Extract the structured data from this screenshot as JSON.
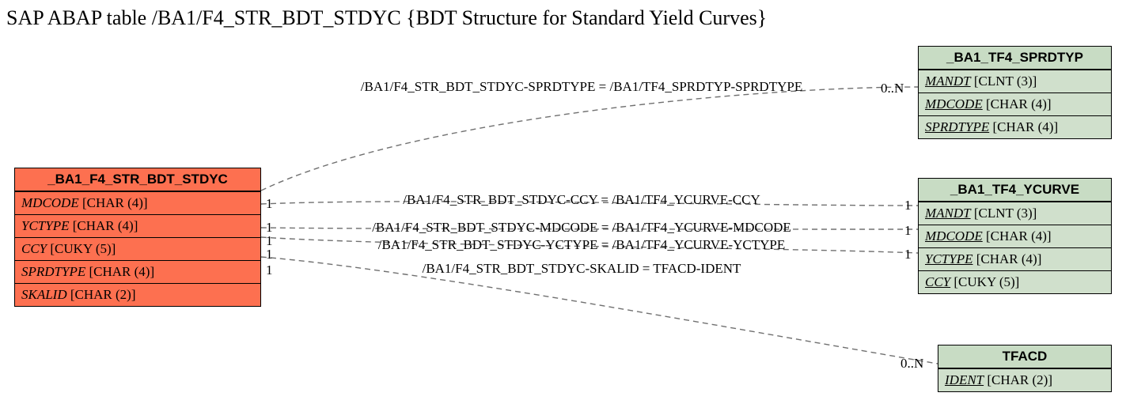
{
  "title": "SAP ABAP table /BA1/F4_STR_BDT_STDYC {BDT Structure for Standard Yield Curves}",
  "left": {
    "name": "_BA1_F4_STR_BDT_STDYC",
    "rows": [
      {
        "name": "MDCODE",
        "type": "[CHAR (4)]",
        "key": false
      },
      {
        "name": "YCTYPE",
        "type": "[CHAR (4)]",
        "key": false
      },
      {
        "name": "CCY",
        "type": "[CUKY (5)]",
        "key": false
      },
      {
        "name": "SPRDTYPE",
        "type": "[CHAR (4)]",
        "key": false
      },
      {
        "name": "SKALID",
        "type": "[CHAR (2)]",
        "key": false
      }
    ]
  },
  "right1": {
    "name": "_BA1_TF4_SPRDTYP",
    "rows": [
      {
        "name": "MANDT",
        "type": "[CLNT (3)]",
        "key": true
      },
      {
        "name": "MDCODE",
        "type": "[CHAR (4)]",
        "key": true
      },
      {
        "name": "SPRDTYPE",
        "type": "[CHAR (4)]",
        "key": true
      }
    ]
  },
  "right2": {
    "name": "_BA1_TF4_YCURVE",
    "rows": [
      {
        "name": "MANDT",
        "type": "[CLNT (3)]",
        "key": true
      },
      {
        "name": "MDCODE",
        "type": "[CHAR (4)]",
        "key": true
      },
      {
        "name": "YCTYPE",
        "type": "[CHAR (4)]",
        "key": true
      },
      {
        "name": "CCY",
        "type": "[CUKY (5)]",
        "key": true
      }
    ]
  },
  "right3": {
    "name": "TFACD",
    "rows": [
      {
        "name": "IDENT",
        "type": "[CHAR (2)]",
        "key": true
      }
    ]
  },
  "rel": {
    "r1": "/BA1/F4_STR_BDT_STDYC-SPRDTYPE = /BA1/TF4_SPRDTYP-SPRDTYPE",
    "r2": "/BA1/F4_STR_BDT_STDYC-CCY = /BA1/TF4_YCURVE-CCY",
    "r3": "/BA1/F4_STR_BDT_STDYC-MDCODE = /BA1/TF4_YCURVE-MDCODE",
    "r4": "/BA1/F4_STR_BDT_STDYC-YCTYPE = /BA1/TF4_YCURVE-YCTYPE",
    "r5": "/BA1/F4_STR_BDT_STDYC-SKALID = TFACD-IDENT"
  },
  "card": {
    "lc1": "1",
    "lc2": "1",
    "lc3": "1",
    "lc4": "1",
    "lc5": "1",
    "rc1": "0..N",
    "rc2a": "1",
    "rc2b": "1",
    "rc2c": "1",
    "rc3": "0..N"
  }
}
